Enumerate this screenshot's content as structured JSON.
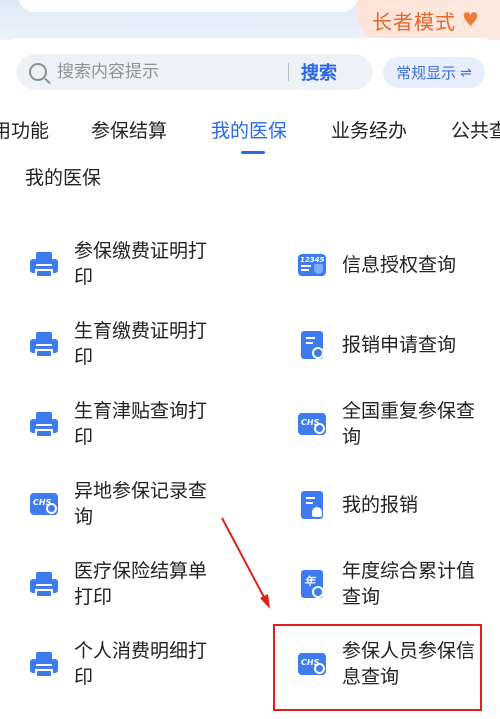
{
  "elder_mode": {
    "label": "长者模式",
    "icon": "heart-icon"
  },
  "search": {
    "placeholder": "搜索内容提示",
    "button": "搜索"
  },
  "display_toggle": {
    "label": "常规显示",
    "icon": "swap-icon"
  },
  "tabs": [
    {
      "label": "用功能"
    },
    {
      "label": "参保结算"
    },
    {
      "label": "我的医保",
      "active": true
    },
    {
      "label": "业务经办"
    },
    {
      "label": "公共查"
    }
  ],
  "section_title": "我的医保",
  "items_left": [
    {
      "label": "参保缴费证明打印",
      "icon": "printer-icon"
    },
    {
      "label": "生育缴费证明打印",
      "icon": "printer-icon"
    },
    {
      "label": "生育津贴查询打印",
      "icon": "printer-icon"
    },
    {
      "label": "异地参保记录查询",
      "icon": "chs-card-icon"
    },
    {
      "label": "医疗保险结算单打印",
      "icon": "printer-icon"
    },
    {
      "label": "个人消费明细打印",
      "icon": "printer-icon"
    }
  ],
  "items_right": [
    {
      "label": "信息授权查询",
      "icon": "12345-icon",
      "icon_text": "12345"
    },
    {
      "label": "报销申请查询",
      "icon": "document-search-icon"
    },
    {
      "label": "全国重复参保查询",
      "icon": "chs-card-icon",
      "icon_text": "CHS"
    },
    {
      "label": "我的报销",
      "icon": "document-user-icon"
    },
    {
      "label": "年度综合累计值查询",
      "icon": "year-document-icon",
      "icon_text": "年"
    },
    {
      "label": "参保人员参保信息查询",
      "icon": "chs-card-icon",
      "icon_text": "CHS"
    }
  ],
  "colors": {
    "accent": "#2a6ae6",
    "highlight": "#e0211b",
    "elder": "#e2672f"
  }
}
